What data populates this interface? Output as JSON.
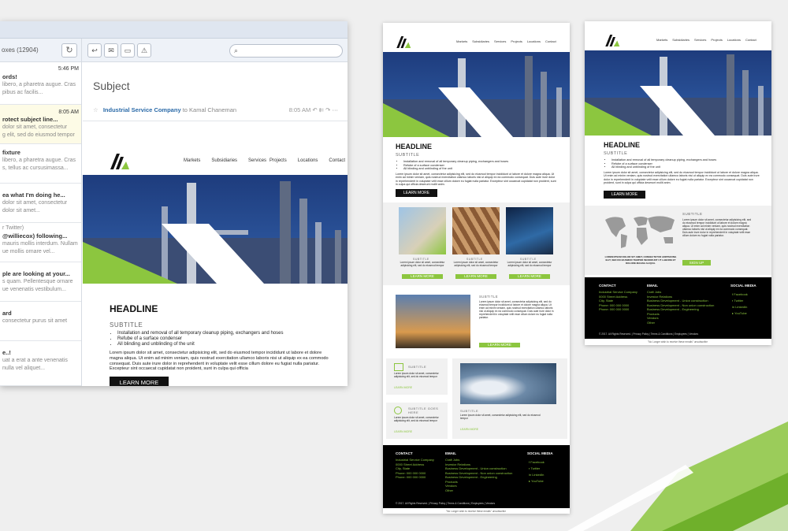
{
  "email": {
    "inbox_title": "oxes (12904)",
    "subject": "Subject",
    "from_company": "Industrial Service Company",
    "from_to": "to Kamal Chaneman",
    "from_time": "8:05 AM",
    "messages": [
      {
        "time": "5:46 PM",
        "subj": "ords!",
        "line1": "libero, a pharetra augue. Cras",
        "line2": "pibus ac facilis..."
      },
      {
        "time": "8:05 AM",
        "subj": "rotect subject line...",
        "line1": "dolor sit amet, consectetur",
        "line2": "g elit, sed do eiusmod tempor"
      },
      {
        "time": "",
        "subj": "fixture",
        "line1": "libero, a pharetra augue. Cras",
        "line2": "s, tellus ac cursusimassa..."
      },
      {
        "time": "",
        "subj": "ea what I'm doing he...",
        "line1": "dolor sit amet, consectetur",
        "line2": "dolor sit amet..."
      },
      {
        "time": "",
        "subj": "@williecox) following...",
        "line1": "r Twitter)",
        "line2": "mauris mollis interdum. Nullam"
      },
      {
        "time": "",
        "subj": "ple are looking at your...",
        "line1": "s quam. Pellentesque ornare",
        "line2": "ue venenatis vestibulum..."
      },
      {
        "time": "",
        "subj": "ard",
        "line1": "consectetur purus sit amet",
        "line2": ""
      },
      {
        "time": "",
        "subj": "e..!",
        "line1": "uat a erat a ante venenatis",
        "line2": "nulla vel aliquet..."
      }
    ],
    "extra_line": "ue mollis ornare vel...",
    "extra_line2": "um nulla vel aliquet..."
  },
  "newsletter": {
    "nav": [
      "Markets",
      "Subsidiaries",
      "Services",
      "Projects",
      "Locations",
      "Contact"
    ],
    "headline": "HEADLINE",
    "subtitle": "SUBTITLE",
    "bullets": [
      "Installation and removal of all temporary cleanup piping, exchangers and hoses",
      "Refube of a surface condenser",
      "All blinding and unblinding of the unit"
    ],
    "paragraph": "Lorem ipsum dolor sit amet, consectetur adipisicing elit, sed do eiusmod tempor incididunt ut labore et dolore magna aliqua. Ut enim ad minim veniam, quis nostrud exercitation ullamco laboris nisi ut aliquip ex ea commodo consequat. Duis aute irure dolor in reprehenderit in voluptate velit esse cillum dolore eu fugiat nulla pariatur. Excepteur sint occaecat cupidatat non proident, sunt in culpa qui officia deserunt mollit anim.",
    "paragraph_short": "Lorem ipsum dolor sit amet, consectetur adipisicing elit, sed do eiusmod tempor incididunt ut labore et dolore magna aliqua. Ut enim ad minim veniam, quis nostrud exercitation ullamco laboris nisi ut aliquip ex ea commodo consequat. Duis aute irure dolor in reprehenderit in voluptate velit esse cillum dolore eu fugiat nulla pariatur. Excepteur sint occaecat cupidatat non proident, sunt in culpa qui officia",
    "learn_more": "LEARN MORE",
    "card_text": "Lorem ipsum dolor sit amet, consectetur adipisicing elit, sed do eiusmod tempor",
    "card_text_long": "Lorem ipsum dolor sit amet, consectetur adipisicing elit, sed do eiusmod tempor incididunt ut labore et dolore magna aliqua. Ut enim ad minim veniam, quis nostrud exercitation ullamco laboris nisi ut aliquip ex ea commodo consequat. Duis aute irure dolor in reprehenderit in voluptate velit esse cillum dolore eu fugiat nulla pariatur.",
    "subtitle_goes_here": "SUBTITLE GOES HERE",
    "map_caption": "LOREM IPSUM DOLOR SIT AMET, CONSECTETUR ADIPISICING ELIT, SED DO EIUSMOD TEMPOR INCIDIDUNT UT LABORE ET DOLORE MAGNA ALIQUA.",
    "signup": "SIGN UP",
    "footer": {
      "contact_head": "CONTACT",
      "email_head": "EMAIL",
      "social_head": "SOCIAL MEDIA",
      "contact_lines": [
        "Industrial Service Company",
        "0000 Street Address",
        "City, State",
        "Phone: 000 000 0000",
        "Phone: 000 000 0000"
      ],
      "email_lines": [
        "Craft Jobs",
        "Investor Relations",
        "Business Development - Union construction",
        "Business Development - Non union construction",
        "Business Development - Engineering",
        "Products",
        "Vendors",
        "Other"
      ],
      "social_lines": [
        "Facebook",
        "Twitter",
        "LinkedIn",
        "YouTube"
      ],
      "copyright": "© 2017. All Rights Reserved. | Privacy Policy | Terms & Conditions | Employees | Vendors",
      "unsubscribe": "\"No Longer wish to receive these emails\" unsubscribe"
    }
  },
  "colors": {
    "accent_green": "#8cc63f",
    "link_blue": "#2b6aa8",
    "footer_black": "#000000"
  }
}
